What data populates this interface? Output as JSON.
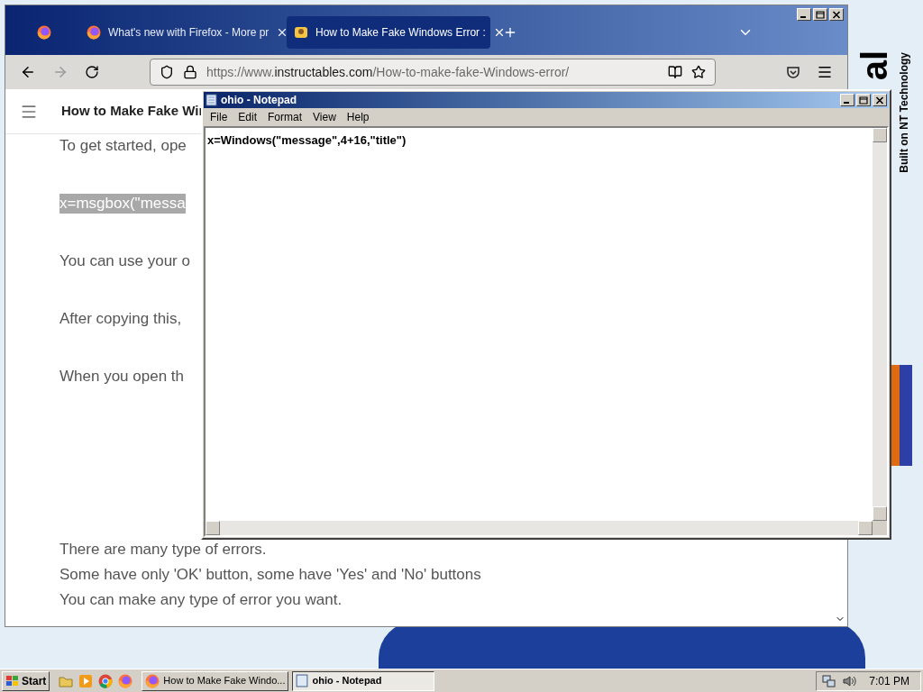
{
  "desktop": {
    "logo_fragment": "al",
    "tagline": "Built on NT Technology"
  },
  "browser": {
    "tabs": [
      {
        "label": "What's new with Firefox - More pr",
        "selected": false
      },
      {
        "label": "How to Make Fake Windows Error :",
        "selected": true
      }
    ],
    "url": {
      "prefix": "https://www.",
      "domain": "instructables.com",
      "path": "/How-to-make-fake-Windows-error/"
    },
    "page_title": "How to Make Fake Wir",
    "sections": [
      {
        "paragraphs": [
          {
            "text": "To get started, ope",
            "highlighted": false
          },
          {
            "text": "x=msgbox(\"messa",
            "highlighted": true
          },
          {
            "text": "You can use your o",
            "highlighted": false
          },
          {
            "text": "After copying this,",
            "highlighted": false
          },
          {
            "text": "When you open th",
            "highlighted": false
          }
        ]
      },
      {
        "paragraphs": [
          {
            "text": "There are many type of errors.",
            "highlighted": false
          },
          {
            "text": "Some have only 'OK' button, some have 'Yes' and 'No' buttons",
            "highlighted": false
          },
          {
            "text": "You can make any type of error you want.",
            "highlighted": false
          }
        ]
      }
    ]
  },
  "notepad": {
    "title": "ohio - Notepad",
    "menu": [
      "File",
      "Edit",
      "Format",
      "View",
      "Help"
    ],
    "content": "x=Windows(\"message\",4+16,\"title\")"
  },
  "taskbar": {
    "start": "Start",
    "tasks": [
      {
        "kind": "firefox",
        "label": "How to Make Fake Windo...",
        "selected": false
      },
      {
        "kind": "notepad",
        "label": "ohio - Notepad",
        "selected": true
      }
    ],
    "clock": "7:01 PM"
  }
}
